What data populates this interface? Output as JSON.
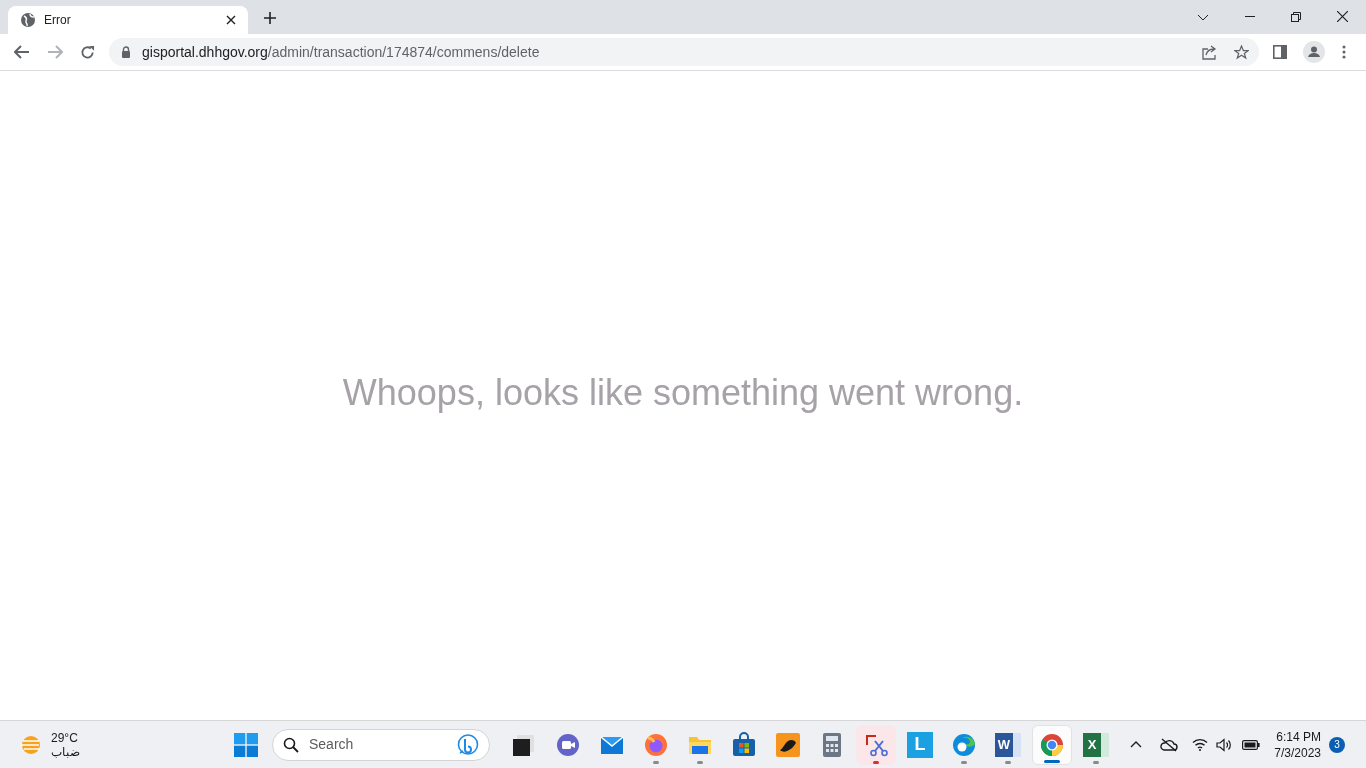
{
  "browser": {
    "tab": {
      "title": "Error"
    },
    "address": {
      "host": "gisportal.dhhgov.org",
      "path": "/admin/transaction/174874/commens/delete"
    }
  },
  "page": {
    "message": "Whoops, looks like something went wrong."
  },
  "taskbar": {
    "weather": {
      "temperature": "29°C",
      "condition": "ضباب"
    },
    "search": {
      "placeholder": "Search"
    },
    "apps": [
      {
        "kind": "taskview",
        "running": false,
        "selected": false
      },
      {
        "kind": "chat",
        "running": false,
        "selected": false
      },
      {
        "kind": "mail",
        "running": false,
        "selected": false
      },
      {
        "kind": "firefox",
        "running": true,
        "selected": false,
        "color": "#8a8a8a"
      },
      {
        "kind": "folder",
        "running": true,
        "selected": false,
        "color": "#8a8a8a"
      },
      {
        "kind": "store",
        "running": false,
        "selected": false
      },
      {
        "kind": "orange",
        "running": false,
        "selected": false
      },
      {
        "kind": "calculator",
        "running": false,
        "selected": false
      },
      {
        "kind": "snip",
        "running": true,
        "selected": false,
        "color": "#d13438"
      },
      {
        "kind": "letter",
        "glyph": "L",
        "running": false,
        "selected": false
      },
      {
        "kind": "edge",
        "running": true,
        "selected": false,
        "color": "#8a8a8a"
      },
      {
        "kind": "word",
        "glyph": "W",
        "running": true,
        "selected": false,
        "color": "#8a8a8a"
      },
      {
        "kind": "chrome",
        "running": true,
        "selected": true,
        "color": "#0067c0"
      },
      {
        "kind": "excel",
        "glyph": "X",
        "running": true,
        "selected": false,
        "color": "#8a8a8a"
      }
    ],
    "clock": {
      "time": "6:14 PM",
      "date": "7/3/2023"
    },
    "notifications": {
      "count": "3"
    }
  }
}
